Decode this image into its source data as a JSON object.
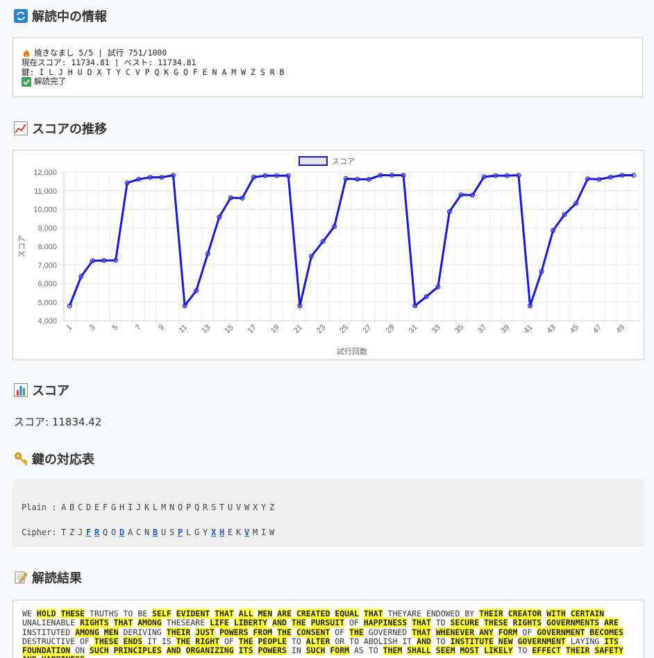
{
  "sections": {
    "info_title": "解読中の情報",
    "chart_title": "スコアの推移",
    "score_title": "スコア",
    "key_title": "鍵の対応表",
    "result_title": "解読結果"
  },
  "info": {
    "line1": "焼きなまし 5/5 | 試行 751/1000",
    "line2": "現在スコア: 11734.81 | ベスト: 11734.81",
    "line3": "鍵: I L J H U D X T Y C V P Q K G O F E N A M W Z S R B",
    "line4": "解読完了"
  },
  "score_text": "スコア: 11834.42",
  "key_table": {
    "plain_label": "Plain :",
    "cipher_label": "Cipher:",
    "plain": [
      "A",
      "B",
      "C",
      "D",
      "E",
      "F",
      "G",
      "H",
      "I",
      "J",
      "K",
      "L",
      "M",
      "N",
      "O",
      "P",
      "Q",
      "R",
      "S",
      "T",
      "U",
      "V",
      "W",
      "X",
      "Y",
      "Z"
    ],
    "cipher": [
      "T",
      "Z",
      "J",
      "F",
      "R",
      "Q",
      "O",
      "D",
      "A",
      "C",
      "N",
      "B",
      "U",
      "S",
      "P",
      "L",
      "G",
      "Y",
      "X",
      "H",
      "E",
      "K",
      "V",
      "M",
      "I",
      "W"
    ],
    "changed": [
      false,
      false,
      false,
      true,
      true,
      false,
      false,
      true,
      false,
      false,
      false,
      true,
      false,
      false,
      true,
      false,
      false,
      false,
      true,
      true,
      false,
      false,
      true,
      false,
      false,
      false
    ]
  },
  "result": {
    "words": [
      [
        "WE",
        false
      ],
      [
        "HOLD",
        true
      ],
      [
        "THESE",
        true
      ],
      [
        "TRUTHS",
        false
      ],
      [
        "TO",
        false
      ],
      [
        "BE",
        false
      ],
      [
        "SELF",
        true
      ],
      [
        "EVIDENT",
        true
      ],
      [
        "THAT",
        true
      ],
      [
        "ALL",
        true
      ],
      [
        "MEN",
        true
      ],
      [
        "ARE",
        true
      ],
      [
        "CREATED",
        true
      ],
      [
        "EQUAL",
        true
      ],
      [
        "THAT",
        true
      ],
      [
        "THEYARE",
        false
      ],
      [
        "ENDOWED",
        false
      ],
      [
        "BY",
        false
      ],
      [
        "THEIR",
        true
      ],
      [
        "CREATOR",
        true
      ],
      [
        "WITH",
        true
      ],
      [
        "CERTAIN",
        true
      ],
      [
        "UNALIENABLE",
        false
      ],
      [
        "RIGHTS",
        true
      ],
      [
        "THAT",
        true
      ],
      [
        "AMONG",
        true
      ],
      [
        "THESEARE",
        false
      ],
      [
        "LIFE",
        true
      ],
      [
        "LIBERTY",
        true
      ],
      [
        "AND",
        true
      ],
      [
        "THE",
        true
      ],
      [
        "PURSUIT",
        true
      ],
      [
        "OF",
        false
      ],
      [
        "HAPPINESS",
        true
      ],
      [
        "THAT",
        true
      ],
      [
        "TO",
        false
      ],
      [
        "SECURE",
        true
      ],
      [
        "THESE",
        true
      ],
      [
        "RIGHTS",
        true
      ],
      [
        "GOVERNMENTS",
        true
      ],
      [
        "ARE",
        true
      ],
      [
        "INSTITUTED",
        false
      ],
      [
        "AMONG",
        true
      ],
      [
        "MEN",
        true
      ],
      [
        "DERIVING",
        false
      ],
      [
        "THEIR",
        true
      ],
      [
        "JUST",
        true
      ],
      [
        "POWERS",
        true
      ],
      [
        "FROM",
        true
      ],
      [
        "THE",
        true
      ],
      [
        "CONSENT",
        true
      ],
      [
        "OF",
        false
      ],
      [
        "THE",
        true
      ],
      [
        "GOVERNED",
        false
      ],
      [
        "THAT",
        true
      ],
      [
        "WHENEVER",
        true
      ],
      [
        "ANY",
        true
      ],
      [
        "FORM",
        true
      ],
      [
        "OF",
        false
      ],
      [
        "GOVERNMENT",
        true
      ],
      [
        "BECOMES",
        true
      ],
      [
        "DESTRUCTIVE",
        false
      ],
      [
        "OF",
        false
      ],
      [
        "THESE",
        true
      ],
      [
        "ENDS",
        true
      ],
      [
        "IT",
        false
      ],
      [
        "IS",
        false
      ],
      [
        "THE",
        true
      ],
      [
        "RIGHT",
        true
      ],
      [
        "OF",
        false
      ],
      [
        "THE",
        true
      ],
      [
        "PEOPLE",
        true
      ],
      [
        "TO",
        false
      ],
      [
        "ALTER",
        true
      ],
      [
        "OR",
        false
      ],
      [
        "TO",
        false
      ],
      [
        "ABOLISH",
        false
      ],
      [
        "IT",
        false
      ],
      [
        "AND",
        true
      ],
      [
        "TO",
        false
      ],
      [
        "INSTITUTE",
        true
      ],
      [
        "NEW",
        true
      ],
      [
        "GOVERNMENT",
        true
      ],
      [
        "LAYING",
        false
      ],
      [
        "ITS",
        true
      ],
      [
        "FOUNDATION",
        true
      ],
      [
        "ON",
        false
      ],
      [
        "SUCH",
        true
      ],
      [
        "PRINCIPLES",
        true
      ],
      [
        "AND",
        true
      ],
      [
        "ORGANIZING",
        true
      ],
      [
        "ITS",
        true
      ],
      [
        "POWERS",
        true
      ],
      [
        "IN",
        false
      ],
      [
        "SUCH",
        true
      ],
      [
        "FORM",
        true
      ],
      [
        "AS",
        false
      ],
      [
        "TO",
        false
      ],
      [
        "THEM",
        true
      ],
      [
        "SHALL",
        true
      ],
      [
        "SEEM",
        true
      ],
      [
        "MOST",
        true
      ],
      [
        "LIKELY",
        true
      ],
      [
        "TO",
        false
      ],
      [
        "EFFECT",
        true
      ],
      [
        "THEIR",
        true
      ],
      [
        "SAFETY",
        true
      ],
      [
        "AND",
        true
      ],
      [
        "HAPPINESS",
        true
      ]
    ]
  },
  "chart_data": {
    "type": "line",
    "legend": "スコア",
    "legend_placement": "top",
    "xlabel": "試行回数",
    "ylabel": "スコア",
    "ylim": [
      4000,
      12000
    ],
    "yticks": [
      4000,
      5000,
      6000,
      7000,
      8000,
      9000,
      10000,
      11000,
      12000
    ],
    "grid": true,
    "color": "#1515dd",
    "x": [
      1,
      2,
      3,
      4,
      5,
      6,
      7,
      8,
      9,
      10,
      11,
      12,
      13,
      14,
      15,
      16,
      17,
      18,
      19,
      20,
      21,
      22,
      23,
      24,
      25,
      26,
      27,
      28,
      29,
      30,
      31,
      32,
      33,
      34,
      35,
      36,
      37,
      38,
      39,
      40,
      41,
      42,
      43,
      44,
      45,
      46,
      47,
      48,
      49,
      50
    ],
    "values": [
      4800,
      6380,
      7230,
      7240,
      7250,
      11420,
      11620,
      11720,
      11720,
      11830,
      4800,
      5620,
      7600,
      9580,
      10620,
      10600,
      11730,
      11810,
      11810,
      11810,
      4800,
      7470,
      8260,
      9070,
      11650,
      11620,
      11610,
      11830,
      11830,
      11830,
      4800,
      5300,
      5820,
      9870,
      10780,
      10760,
      11750,
      11810,
      11810,
      11830,
      4800,
      6650,
      8860,
      9720,
      10320,
      11640,
      11610,
      11730,
      11830,
      11830
    ],
    "xtick_labels": [
      "1",
      "3",
      "5",
      "7",
      "9",
      "11",
      "13",
      "15",
      "17",
      "19",
      "21",
      "23",
      "25",
      "27",
      "29",
      "31",
      "33",
      "35",
      "37",
      "39",
      "41",
      "43",
      "45",
      "47",
      "49"
    ]
  }
}
